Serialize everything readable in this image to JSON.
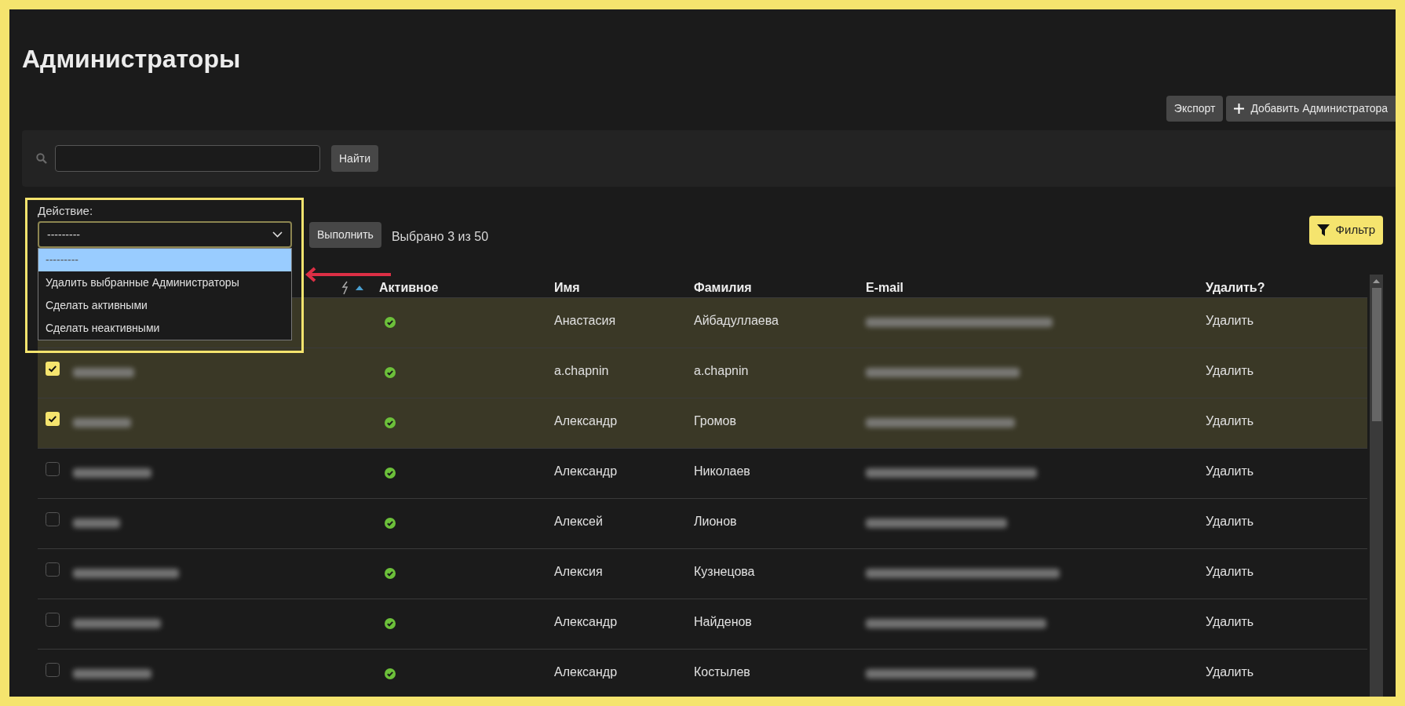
{
  "page": {
    "title": "Администраторы"
  },
  "toolbar": {
    "buttons": [
      {
        "kind": "plain",
        "label": "Экспорт"
      },
      {
        "kind": "add",
        "label": "Добавить Администратора"
      }
    ]
  },
  "search": {
    "button": "Найти"
  },
  "action": {
    "label": "Действие:",
    "value": "---------",
    "expanded": true,
    "options": [
      {
        "label": "---------",
        "selected": true
      },
      {
        "label": "Удалить выбранные Администраторы",
        "selected": false
      },
      {
        "label": "Сделать активными",
        "selected": false
      },
      {
        "label": "Сделать неактивными",
        "selected": false
      }
    ],
    "run_button": "Выполнить",
    "selection_count": "Выбрано 3 из 50"
  },
  "filter_button": "Фильтр",
  "table": {
    "columns": [
      "Активное",
      "Имя",
      "Фамилия",
      "E-mail",
      "Удалить?"
    ],
    "rows": [
      {
        "selected": true,
        "active": true,
        "first_name": "Анастасия",
        "last_name": "Айбадуллаева",
        "delete": "Удалить"
      },
      {
        "selected": true,
        "active": true,
        "first_name": "a.chapnin",
        "last_name": "a.chapnin",
        "delete": "Удалить"
      },
      {
        "selected": true,
        "active": true,
        "first_name": "Александр",
        "last_name": "Громов",
        "delete": "Удалить"
      },
      {
        "selected": false,
        "active": true,
        "first_name": "Александр",
        "last_name": "Николаев",
        "delete": "Удалить"
      },
      {
        "selected": false,
        "active": true,
        "first_name": "Алексей",
        "last_name": "Лионов",
        "delete": "Удалить"
      },
      {
        "selected": false,
        "active": true,
        "first_name": "Алексия",
        "last_name": "Кузнецова",
        "delete": "Удалить"
      },
      {
        "selected": false,
        "active": true,
        "first_name": "Александр",
        "last_name": "Найденов",
        "delete": "Удалить"
      },
      {
        "selected": false,
        "active": true,
        "first_name": "Александр",
        "last_name": "Костылев",
        "delete": "Удалить"
      }
    ]
  }
}
